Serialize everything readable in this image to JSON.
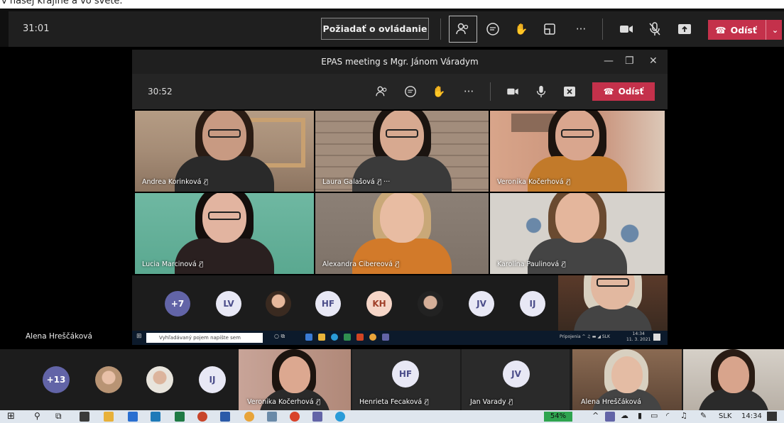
{
  "caption": "v našej krajine a vo svete.",
  "outer": {
    "timer": "31:01",
    "request_control": "Požiadať o ovládanie",
    "leave": "Odísť"
  },
  "window": {
    "title": "EPAS meeting s Mgr. Jánom Váradym",
    "timer": "30:52",
    "leave": "Odísť"
  },
  "tiles": [
    {
      "name": "Andrea Korinková",
      "more": ""
    },
    {
      "name": "Laura Galašová",
      "more": "···"
    },
    {
      "name": "Veronika Kočerhová",
      "more": ""
    },
    {
      "name": "Lucia Marcinová",
      "more": ""
    },
    {
      "name": "Alexandra Cibereová",
      "more": ""
    },
    {
      "name": "Karolína Paulinová",
      "more": ""
    }
  ],
  "inner_avatars": [
    "+7",
    "LV",
    "",
    "HF",
    "KH",
    "",
    "JV",
    "IJ"
  ],
  "inner_taskbar": {
    "search_placeholder": "Vyhľadávaný pojem napíšte sem",
    "tray": "Pripojenia ^ ♫ ▬ ◢ SLK",
    "time": "14:34",
    "date": "11. 3. 2021"
  },
  "left_label": "Alena Hreščáková",
  "bottom_row": {
    "count_badge": "+13",
    "hf": "HF",
    "jv": "JV",
    "ij": "IJ",
    "names": [
      "Veronika Kočerhová",
      "Henrieta Fecaková",
      "Jan Varady",
      "Alena Hreščáková"
    ]
  },
  "taskbar": {
    "battery": "54%",
    "lang": "SLK",
    "time": "14:34"
  },
  "colors": {
    "leave_red": "#c4314b",
    "avatar_purple": "#6264a7",
    "avatar_light": "#e8e8f5"
  }
}
